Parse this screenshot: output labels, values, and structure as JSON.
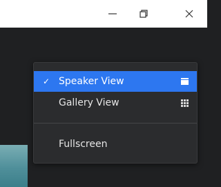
{
  "window_controls": {
    "minimize_icon": "minimize-icon",
    "restore_icon": "restore-icon",
    "close_icon": "close-icon"
  },
  "menu": {
    "items": [
      {
        "label": "Speaker View",
        "checked": true,
        "check_glyph": "✓",
        "icon": "speaker-view-icon"
      },
      {
        "label": "Gallery View",
        "checked": false,
        "icon": "gallery-grid-icon"
      },
      {
        "label": "Fullscreen",
        "checked": false
      }
    ]
  },
  "colors": {
    "selected_bg": "#2d77f0",
    "menu_bg": "#2b2c2e",
    "window_bg": "#1f2022"
  }
}
